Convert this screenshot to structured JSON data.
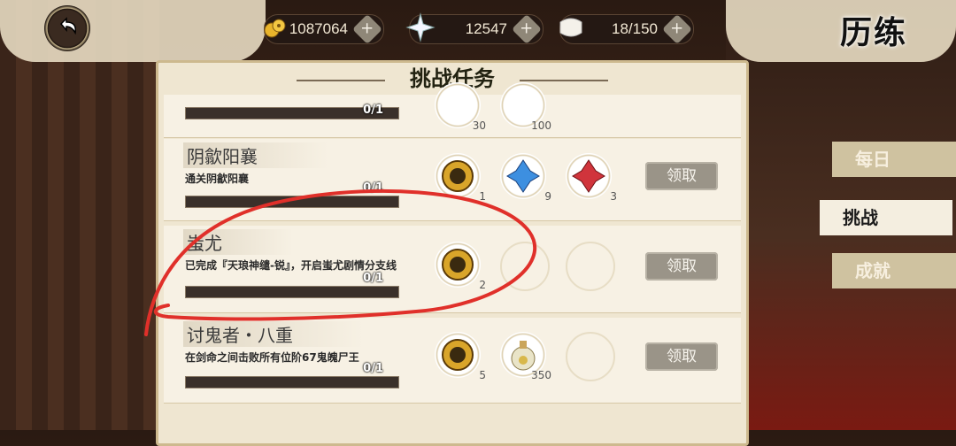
{
  "header": {
    "title": "历练",
    "resources": [
      {
        "icon": "gold-coin-icon",
        "value": "1087064"
      },
      {
        "icon": "star-crystal-icon",
        "value": "12547"
      },
      {
        "icon": "stamina-icon",
        "value": "18/150"
      }
    ]
  },
  "panel": {
    "title": "挑战任务",
    "tasks": [
      {
        "name": "",
        "desc": "",
        "progress": "0/1",
        "claim": "",
        "rewards": [
          "",
          "30",
          "100"
        ]
      },
      {
        "name": "阴歙阳襄",
        "desc": "通关阴歙阳襄",
        "progress": "0/1",
        "claim": "领取",
        "rewards": [
          "1",
          "9",
          "3"
        ]
      },
      {
        "name": "蚩尤",
        "desc": "已完成『天琅神缱-锐』，开启蚩尤剧情分支线",
        "progress": "0/1",
        "claim": "领取",
        "rewards": [
          "2"
        ]
      },
      {
        "name": "讨鬼者・八重",
        "desc": "在剑命之间击败所有位阶67鬼魄尸王",
        "progress": "0/1",
        "claim": "领取",
        "rewards": [
          "5",
          "350"
        ]
      }
    ]
  },
  "tabs": [
    {
      "label": "每日",
      "active": false
    },
    {
      "label": "挑战",
      "active": true
    },
    {
      "label": "成就",
      "active": false
    }
  ],
  "colors": {
    "accent": "#cdb98e",
    "panel": "#efe6d1",
    "annotation": "#e0302a"
  }
}
